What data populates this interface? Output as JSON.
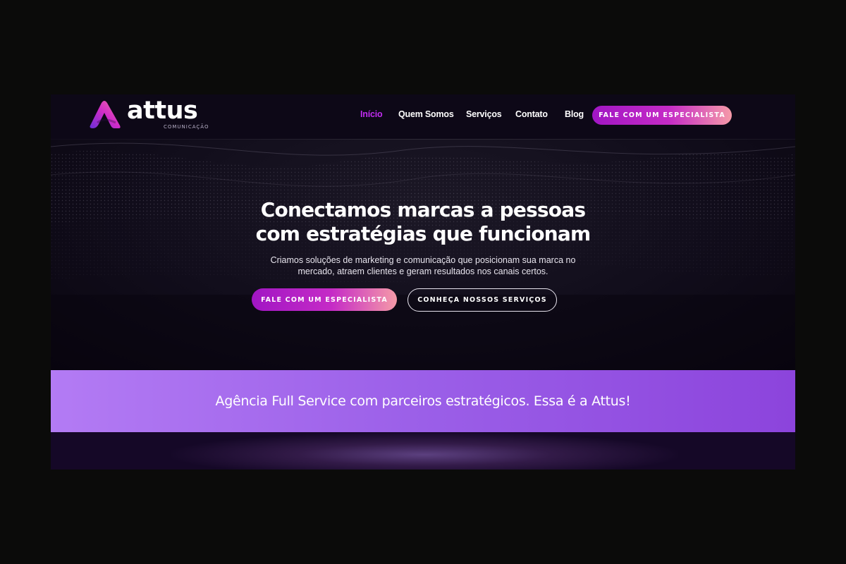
{
  "logo": {
    "name": "attus",
    "tagline": "COMUNICAÇÃO"
  },
  "nav": {
    "items": [
      {
        "label": "Início",
        "active": true
      },
      {
        "label": "Quem Somos",
        "active": false
      },
      {
        "label": "Serviços",
        "active": false
      },
      {
        "label": "Contato",
        "active": false
      },
      {
        "label": "Blog",
        "active": false
      }
    ],
    "cta_label": "FALE COM UM ESPECIALISTA"
  },
  "hero": {
    "title_line1": "Conectamos marcas a pessoas",
    "title_line2": "com estratégias que funcionam",
    "subtitle_line1": "Criamos soluções de marketing e comunicação que posicionam sua marca no",
    "subtitle_line2": "mercado, atraem clientes e geram resultados nos canais certos.",
    "primary_button": "FALE COM UM ESPECIALISTA",
    "secondary_button": "CONHEÇA NOSSOS SERVIÇOS"
  },
  "banner": {
    "text": "Agência Full Service com parceiros estratégicos. Essa é a Attus!"
  },
  "colors": {
    "accent": "#c02cf0",
    "gradient_start": "#a116c4",
    "gradient_end": "#f59aa8",
    "banner": "#9b5fe8",
    "background": "#0c0716"
  }
}
